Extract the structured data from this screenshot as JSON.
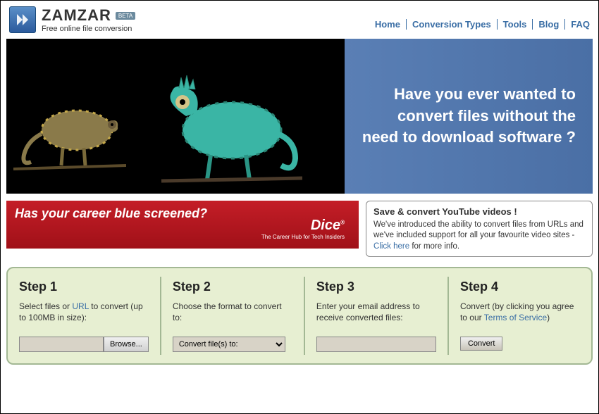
{
  "header": {
    "brand": "ZAMZAR",
    "beta": "BETA",
    "subtitle": "Free online file conversion"
  },
  "nav": {
    "items": [
      "Home",
      "Conversion Types",
      "Tools",
      "Blog",
      "FAQ"
    ]
  },
  "hero": {
    "text": "Have you ever wanted to convert files without the need to download software ?"
  },
  "dice": {
    "heading": "Has your career blue screened?",
    "logo": "Dice",
    "tagline": "The Career Hub for Tech Insiders"
  },
  "youtube": {
    "title": "Save & convert YouTube videos !",
    "body_pre": "We've introduced the ability to convert files from URLs and we've included support for all your favourite video sites - ",
    "link": "Click here",
    "body_post": " for more info."
  },
  "steps": [
    {
      "title": "Step 1",
      "desc_pre": "Select files or ",
      "link": "URL",
      "desc_post": " to convert (up to 100MB in size):",
      "browse": "Browse..."
    },
    {
      "title": "Step 2",
      "desc": "Choose the format to convert to:",
      "select_label": "Convert file(s) to:"
    },
    {
      "title": "Step 3",
      "desc": "Enter your email address to receive converted files:"
    },
    {
      "title": "Step 4",
      "desc_pre": "Convert (by clicking you agree to our ",
      "link": "Terms of Service",
      "desc_post": ")",
      "button": "Convert"
    }
  ]
}
